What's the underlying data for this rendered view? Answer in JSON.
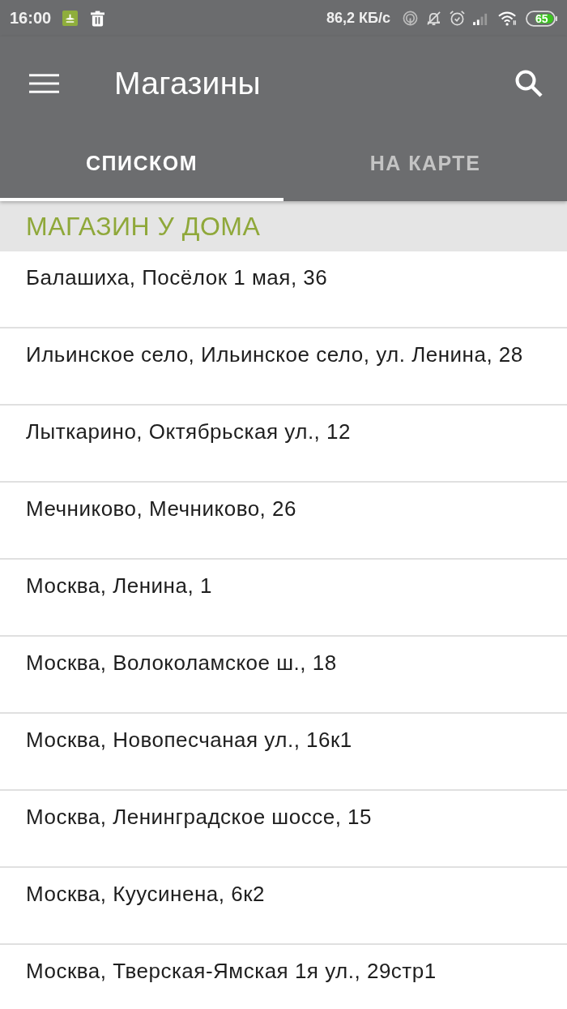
{
  "status_bar": {
    "time": "16:00",
    "network_speed": "86,2 КБ/с",
    "battery": "65"
  },
  "app_bar": {
    "title": "Магазины"
  },
  "tabs": [
    {
      "label": "СПИСКОМ",
      "selected": true
    },
    {
      "label": "НА КАРТЕ",
      "selected": false
    }
  ],
  "section": {
    "title": "МАГАЗИН У ДОМА"
  },
  "stores": [
    "Балашиха, Посёлок 1 мая, 36",
    "Ильинское село, Ильинское село, ул. Ленина, 28",
    "Лыткарино, Октябрьская ул., 12",
    "Мечниково, Мечниково, 26",
    "Москва, Ленина, 1",
    "Москва, Волоколамское ш., 18",
    "Москва, Новопесчаная ул., 16к1",
    "Москва, Ленинградское шоссе, 15",
    "Москва, Куусинена, 6к2",
    "Москва, Тверская-Ямская 1я ул., 29стр1"
  ]
}
